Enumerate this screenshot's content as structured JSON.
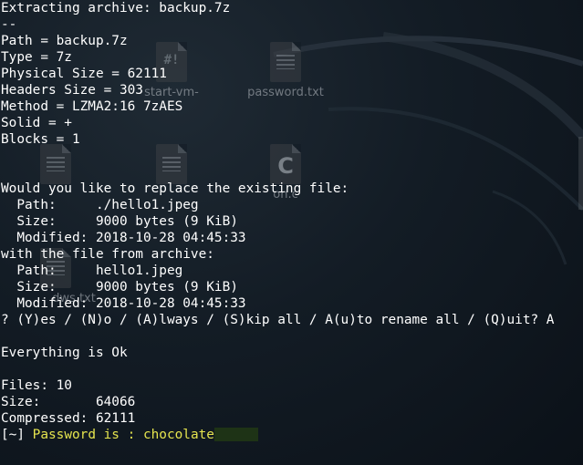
{
  "terminal": {
    "lines": [
      "Extracting archive: backup.7z",
      "--",
      "Path = backup.7z",
      "Type = 7z",
      "Physical Size = 62111",
      "Headers Size = 303",
      "Method = LZMA2:16 7zAES",
      "Solid = +",
      "Blocks = 1",
      "",
      "",
      "Would you like to replace the existing file:",
      "  Path:     ./hello1.jpeg",
      "  Size:     9000 bytes (9 KiB)",
      "  Modified: 2018-10-28 04:45:33",
      "with the file from archive:",
      "  Path:     hello1.jpeg",
      "  Size:     9000 bytes (9 KiB)",
      "  Modified: 2018-10-28 04:45:33",
      "? (Y)es / (N)o / (A)lways / (S)kip all / A(u)to rename all / (Q)uit? A",
      "",
      "Everything is Ok",
      "",
      "Files: 10",
      "Size:       64066",
      "Compressed: 62111"
    ],
    "prompt_prefix": "[~]",
    "prompt_output": "Password is : chocolate"
  },
  "desktop": {
    "icons": [
      {
        "label": "start-vm-",
        "icon": "script-icon"
      },
      {
        "label": "password.txt",
        "icon": "text-file-icon"
      },
      {
        "label": "on.c",
        "icon": "c-source-icon"
      },
      {
        "label": "dws.txt",
        "icon": "text-file-icon"
      }
    ]
  },
  "colors": {
    "terminal_text": "#ffffff",
    "highlight_text": "#e5e44e",
    "background": "#0d1620"
  }
}
